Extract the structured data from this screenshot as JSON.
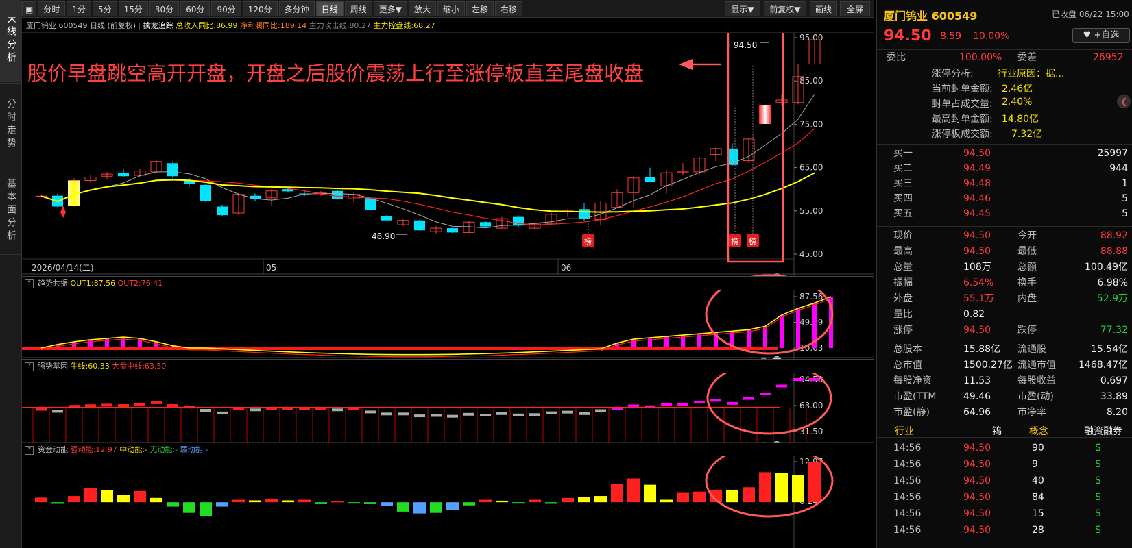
{
  "side_tabs": [
    "K线分析",
    "分时走势",
    "基本面分析"
  ],
  "toolbar": {
    "fullscreen_icon": "window-icon",
    "periods": [
      "分时",
      "1分",
      "5分",
      "15分",
      "30分",
      "60分",
      "90分",
      "120分",
      "多分钟",
      "日线",
      "周线",
      "更多▼"
    ],
    "active_period": "日线",
    "actions": [
      "放大",
      "缩小",
      "左移",
      "右移"
    ],
    "right_buttons": [
      "显示▼",
      "前复权▼",
      "画线",
      "全屏"
    ]
  },
  "info_bar": {
    "stock": "厦门钨业 600549 日线",
    "adjust": "(前复权)",
    "indicator": "擒龙追踪",
    "rev_growth": "总收入同比:86.99",
    "profit_growth": "净利润同比:189.14",
    "attack_line": "主力攻击线:80.27",
    "control_line": "主力控盘线:68.27"
  },
  "annotation_text": "股价早盘跳空高开开盘，开盘之后股价震荡上行至涨停板直至尾盘收盘",
  "colors": {
    "up": "#ff3b3b",
    "down": "#00e5ff",
    "ma_yellow": "#ffff00",
    "ma_red": "#ff2020",
    "magenta": "#ff00ff",
    "highlight": "#ff5a5a"
  },
  "price_axis": [
    "95.00",
    "85.00",
    "75.00",
    "65.00",
    "55.00",
    "45.00"
  ],
  "date_axis": [
    "2026/04/14(二)",
    "05",
    "06"
  ],
  "price_labels": {
    "high": "94.50",
    "low": "48.90"
  },
  "rank_badge": "榜",
  "candles": [
    [
      58.3,
      58.6,
      58.1,
      58.4
    ],
    [
      58.5,
      59.0,
      55.8,
      56.0
    ],
    [
      56.2,
      62.5,
      56.0,
      62.0
    ],
    [
      62.0,
      63.2,
      61.5,
      62.8
    ],
    [
      63.0,
      64.0,
      62.2,
      63.5
    ],
    [
      63.8,
      64.8,
      62.8,
      63.0
    ],
    [
      63.2,
      64.6,
      62.8,
      64.2
    ],
    [
      64.0,
      66.6,
      63.8,
      66.4
    ],
    [
      66.0,
      66.5,
      62.5,
      63.0
    ],
    [
      62.0,
      62.6,
      60.6,
      61.2
    ],
    [
      61.0,
      61.2,
      57.0,
      57.2
    ],
    [
      56.0,
      56.4,
      53.8,
      54.0
    ],
    [
      54.5,
      59.2,
      54.0,
      58.8
    ],
    [
      58.5,
      59.0,
      57.2,
      57.8
    ],
    [
      58.0,
      60.0,
      56.2,
      59.6
    ],
    [
      60.0,
      60.5,
      59.2,
      59.5
    ],
    [
      59.0,
      59.6,
      58.4,
      58.8
    ],
    [
      59.0,
      59.6,
      58.4,
      59.2
    ],
    [
      59.6,
      59.8,
      57.6,
      57.8
    ],
    [
      57.8,
      59.2,
      57.0,
      58.8
    ],
    [
      58.0,
      58.2,
      55.0,
      55.2
    ],
    [
      53.8,
      54.0,
      52.6,
      52.8
    ],
    [
      51.8,
      53.2,
      51.5,
      52.8
    ],
    [
      52.8,
      53.0,
      50.4,
      50.5
    ],
    [
      50.2,
      51.5,
      49.6,
      51.0
    ],
    [
      51.0,
      51.2,
      49.8,
      50.0
    ],
    [
      50.0,
      52.6,
      49.9,
      52.4
    ],
    [
      52.4,
      52.8,
      51.2,
      51.4
    ],
    [
      51.0,
      53.6,
      50.8,
      53.2
    ],
    [
      53.6,
      54.0,
      51.2,
      51.6
    ],
    [
      51.0,
      52.4,
      50.6,
      52.0
    ],
    [
      52.0,
      54.6,
      51.8,
      54.2
    ],
    [
      54.8,
      55.4,
      53.6,
      55.0
    ],
    [
      55.4,
      56.8,
      52.6,
      53.2
    ],
    [
      53.0,
      57.2,
      51.6,
      56.8
    ],
    [
      55.8,
      60.0,
      55.6,
      59.2
    ],
    [
      59.2,
      63.0,
      55.6,
      62.6
    ],
    [
      62.8,
      65.0,
      61.8,
      61.6
    ],
    [
      60.8,
      64.5,
      59.0,
      63.8
    ],
    [
      63.8,
      66.0,
      63.2,
      64.0
    ],
    [
      64.0,
      67.5,
      63.4,
      67.2
    ],
    [
      68.0,
      69.8,
      66.5,
      69.4
    ],
    [
      69.4,
      70.6,
      65.3,
      65.6
    ],
    [
      66.6,
      71.6,
      66.0,
      71.6
    ],
    [
      77.2,
      79.4,
      77.1,
      77.1
    ],
    [
      80.0,
      82.0,
      79.2,
      80.6
    ],
    [
      80.0,
      88.8,
      79.6,
      86.0
    ],
    [
      88.9,
      94.5,
      88.88,
      94.5
    ]
  ],
  "tooltip_high": "94.50",
  "panel1": {
    "name": "趋势共振",
    "out1": "OUT1:87.56",
    "out2": "OUT2:76.41",
    "axis": [
      "87.56",
      "49.09",
      "10.63"
    ],
    "baseline": 10.63,
    "bars": [
      10.6,
      16,
      20,
      23,
      25,
      27,
      25,
      20,
      14,
      10.6,
      10.6,
      10.6,
      10.6,
      10.6,
      10.6,
      10.6,
      10.6,
      10.6,
      10.6,
      10.6,
      10.6,
      10.6,
      10.6,
      10.6,
      10.6,
      10.6,
      10.6,
      10.6,
      10.6,
      10.6,
      10.6,
      10.6,
      10.6,
      10.6,
      10.6,
      18,
      24,
      26,
      28,
      30,
      32,
      34,
      36,
      38,
      43,
      60,
      70,
      78,
      87.56
    ]
  },
  "panel2": {
    "name": "强势基因",
    "bull": "牛线:60.33",
    "market": "大盘中线:63.50",
    "axis": [
      "94.50",
      "63.00",
      "31.50"
    ]
  },
  "panel3": {
    "name": "资金动能",
    "strong": "强动能:12.97",
    "mid": "中动能:-",
    "none": "无动能:-",
    "weak": "弱动能:-",
    "axis": [
      "12.97",
      "6.61",
      "0.24"
    ],
    "bars": [
      1.5,
      -0.5,
      2.0,
      4.6,
      3.8,
      2.4,
      3.6,
      1.4,
      -1.4,
      -3.4,
      -4.4,
      -1.4,
      0.8,
      0.6,
      1.0,
      0.6,
      0.8,
      -0.6,
      0.4,
      -0.4,
      -0.6,
      -1.2,
      -3.0,
      -3.6,
      -3.4,
      -2.4,
      -1.0,
      0.8,
      0.5,
      -0.3,
      0.8,
      -0.5,
      1.4,
      1.8,
      2.0,
      5.8,
      7.6,
      5.6,
      0.8,
      3.2,
      3.4,
      4.0,
      4.0,
      4.8,
      9.6,
      9.4,
      8.6,
      12.97
    ],
    "bar_colors": [
      "r",
      "g",
      "r",
      "r",
      "y",
      "y",
      "r",
      "y",
      "g",
      "g",
      "g",
      "b",
      "r",
      "y",
      "r",
      "y",
      "r",
      "g",
      "r",
      "g",
      "g",
      "b",
      "g",
      "b",
      "g",
      "b",
      "g",
      "r",
      "y",
      "g",
      "r",
      "g",
      "r",
      "y",
      "y",
      "r",
      "r",
      "y",
      "y",
      "r",
      "r",
      "r",
      "y",
      "r",
      "r",
      "y",
      "y",
      "r"
    ]
  },
  "quote": {
    "name": "厦门钨业 600549",
    "status": "已收盘 06/22 15:00",
    "price": "94.50",
    "change": "8.59",
    "pct": "10.00%",
    "watch_button": "+自选",
    "weibi_label": "委比",
    "weibi": "100.00%",
    "weicha_label": "委差",
    "weicha": "26952",
    "limit_analysis": "涨停分析:",
    "limit_reason": "行业原因：据...",
    "seal_amount": "当前封单金额:",
    "seal_amount_val": "2.46亿",
    "seal_ratio": "封单占成交量:",
    "seal_ratio_val": "2.40%",
    "max_seal": "最高封单金额:",
    "max_seal_val": "14.80亿",
    "limit_turnover": "涨停板成交额:",
    "limit_turnover_val": "7.32亿",
    "bids": [
      [
        "买一",
        "94.50",
        "25997"
      ],
      [
        "买二",
        "94.49",
        "944"
      ],
      [
        "买三",
        "94.48",
        "1"
      ],
      [
        "买四",
        "94.46",
        "5"
      ],
      [
        "买五",
        "94.45",
        "5"
      ]
    ],
    "stats": [
      [
        "现价",
        "94.50",
        "今开",
        "88.92"
      ],
      [
        "最高",
        "94.50",
        "最低",
        "88.88"
      ],
      [
        "总量",
        "108万",
        "总额",
        "100.49亿"
      ],
      [
        "振幅",
        "6.54%",
        "换手",
        "6.98%"
      ],
      [
        "外盘",
        "55.1万",
        "内盘",
        "52.9万"
      ],
      [
        "量比",
        "0.82",
        "",
        ""
      ],
      [
        "涨停",
        "94.50",
        "跌停",
        "77.32"
      ]
    ],
    "funds": [
      [
        "总股本",
        "15.88亿",
        "流通股",
        "15.54亿"
      ],
      [
        "总市值",
        "1500.27亿",
        "流通市值",
        "1468.47亿"
      ],
      [
        "每股净资",
        "11.53",
        "每股收益",
        "0.697"
      ],
      [
        "市盈(TTM",
        "49.46",
        "市盈(动)",
        "33.89"
      ],
      [
        "市盈(静)",
        "64.96",
        "市净率",
        "8.20"
      ]
    ],
    "tabs": [
      "行业",
      "钨",
      "概念",
      "融资融券"
    ],
    "ticks": [
      [
        "14:56",
        "94.50",
        "90",
        "S"
      ],
      [
        "14:56",
        "94.50",
        "9",
        "S"
      ],
      [
        "14:56",
        "94.50",
        "40",
        "S"
      ],
      [
        "14:56",
        "94.50",
        "84",
        "S"
      ],
      [
        "14:56",
        "94.50",
        "15",
        "S"
      ],
      [
        "14:56",
        "94.50",
        "28",
        "S"
      ]
    ]
  }
}
